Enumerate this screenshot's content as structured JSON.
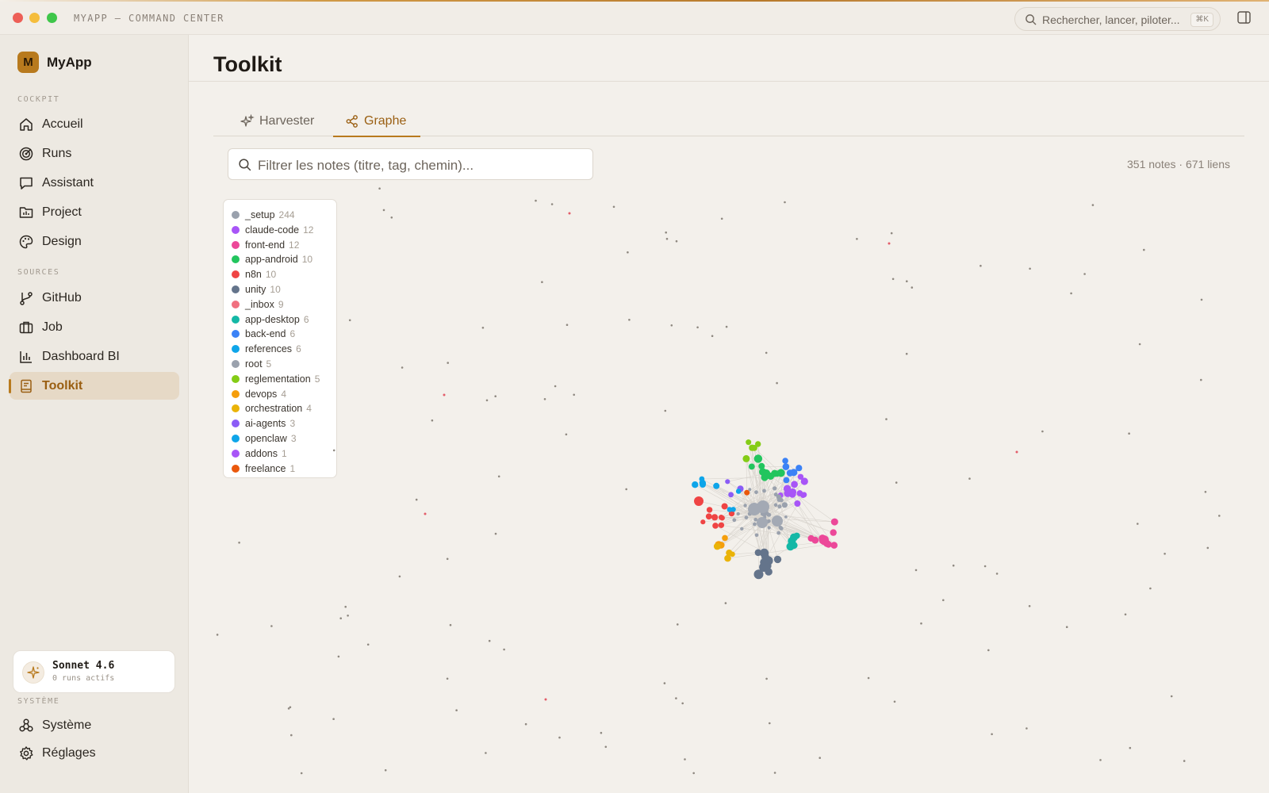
{
  "window": {
    "title": "MYAPP — COMMAND CENTER",
    "search_placeholder": "Rechercher, lancer, piloter...",
    "search_shortcut": "⌘K",
    "traffic_lights": [
      "#ed5f57",
      "#f5bd3c",
      "#3fc64a"
    ]
  },
  "sidebar": {
    "brand_initial": "M",
    "brand_name": "MyApp",
    "sections": [
      {
        "label": "COCKPIT",
        "items": [
          {
            "label": "Accueil",
            "icon": "home-icon"
          },
          {
            "label": "Runs",
            "icon": "target-icon"
          },
          {
            "label": "Assistant",
            "icon": "chat-icon"
          },
          {
            "label": "Project",
            "icon": "folder-chart-icon"
          },
          {
            "label": "Design",
            "icon": "palette-icon"
          }
        ]
      },
      {
        "label": "SOURCES",
        "items": [
          {
            "label": "GitHub",
            "icon": "git-branch-icon"
          },
          {
            "label": "Job",
            "icon": "briefcase-icon"
          },
          {
            "label": "Dashboard BI",
            "icon": "bar-chart-icon"
          },
          {
            "label": "Toolkit",
            "icon": "book-icon",
            "active": true
          }
        ]
      }
    ],
    "model": {
      "name": "Sonnet 4.6",
      "status": "0 runs actifs"
    },
    "system": {
      "label": "SYSTÈME",
      "items": [
        {
          "label": "Système",
          "icon": "network-icon"
        },
        {
          "label": "Réglages",
          "icon": "gear-icon"
        }
      ]
    }
  },
  "main": {
    "title": "Toolkit",
    "tabs": [
      {
        "label": "Harvester",
        "icon": "sparkles-icon"
      },
      {
        "label": "Graphe",
        "icon": "share-icon",
        "active": true
      }
    ],
    "filter_placeholder": "Filtrer les notes (titre, tag, chemin)...",
    "stats": "351 notes · 671 liens",
    "accent_color": "#b87a1e"
  },
  "legend": [
    {
      "name": "_setup",
      "count": "244",
      "color": "#9aa1ad"
    },
    {
      "name": "claude-code",
      "count": "12",
      "color": "#a855f7"
    },
    {
      "name": "front-end",
      "count": "12",
      "color": "#ec4899"
    },
    {
      "name": "app-android",
      "count": "10",
      "color": "#22c55e"
    },
    {
      "name": "n8n",
      "count": "10",
      "color": "#ef4444"
    },
    {
      "name": "unity",
      "count": "10",
      "color": "#64748b"
    },
    {
      "name": "_inbox",
      "count": "9",
      "color": "#f07080"
    },
    {
      "name": "app-desktop",
      "count": "6",
      "color": "#14b8a6"
    },
    {
      "name": "back-end",
      "count": "6",
      "color": "#3b82f6"
    },
    {
      "name": "references",
      "count": "6",
      "color": "#0ea5e9"
    },
    {
      "name": "root",
      "count": "5",
      "color": "#9aa1ad"
    },
    {
      "name": "reglementation",
      "count": "5",
      "color": "#84cc16"
    },
    {
      "name": "devops",
      "count": "4",
      "color": "#f59e0b"
    },
    {
      "name": "orchestration",
      "count": "4",
      "color": "#eab308"
    },
    {
      "name": "ai-agents",
      "count": "3",
      "color": "#8b5cf6"
    },
    {
      "name": "openclaw",
      "count": "3",
      "color": "#0ea5e9"
    },
    {
      "name": "addons",
      "count": "1",
      "color": "#a855f7"
    },
    {
      "name": "freelance",
      "count": "1",
      "color": "#ea580c"
    }
  ]
}
